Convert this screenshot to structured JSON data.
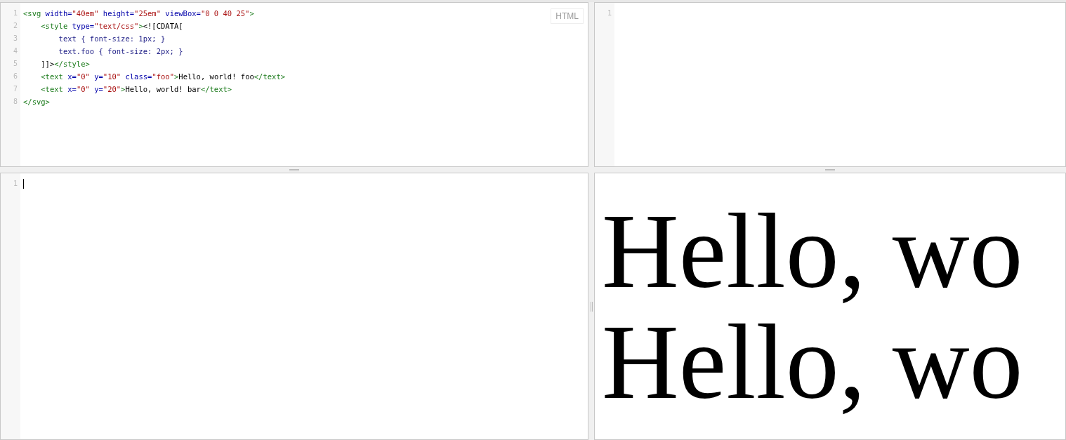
{
  "html_editor": {
    "label": "HTML",
    "lines": [
      {
        "number": "1",
        "tokens": [
          {
            "kind": "tag",
            "text": "<svg "
          },
          {
            "kind": "attr",
            "text": "width="
          },
          {
            "kind": "string",
            "text": "\"40em\""
          },
          {
            "kind": "attr",
            "text": " height="
          },
          {
            "kind": "string",
            "text": "\"25em\""
          },
          {
            "kind": "attr",
            "text": " viewBox="
          },
          {
            "kind": "string",
            "text": "\"0 0 40 25\""
          },
          {
            "kind": "tag",
            "text": ">"
          }
        ]
      },
      {
        "number": "2",
        "tokens": [
          {
            "kind": "tag",
            "text": "    <style "
          },
          {
            "kind": "attr",
            "text": "type="
          },
          {
            "kind": "string",
            "text": "\"text/css\""
          },
          {
            "kind": "tag",
            "text": ">"
          },
          {
            "kind": "text",
            "text": "<![CDATA["
          }
        ]
      },
      {
        "number": "3",
        "tokens": [
          {
            "kind": "css",
            "text": "        text { font-size: 1px; }"
          }
        ]
      },
      {
        "number": "4",
        "tokens": [
          {
            "kind": "css",
            "text": "        text.foo { font-size: 2px; }"
          }
        ]
      },
      {
        "number": "5",
        "tokens": [
          {
            "kind": "text",
            "text": "    ]]>"
          },
          {
            "kind": "tag",
            "text": "</style>"
          }
        ]
      },
      {
        "number": "6",
        "tokens": [
          {
            "kind": "tag",
            "text": "    <text "
          },
          {
            "kind": "attr",
            "text": "x="
          },
          {
            "kind": "string",
            "text": "\"0\""
          },
          {
            "kind": "attr",
            "text": " y="
          },
          {
            "kind": "string",
            "text": "\"10\""
          },
          {
            "kind": "attr",
            "text": " class="
          },
          {
            "kind": "string",
            "text": "\"foo\""
          },
          {
            "kind": "tag",
            "text": ">"
          },
          {
            "kind": "text",
            "text": "Hello, world! foo"
          },
          {
            "kind": "tag",
            "text": "</text>"
          }
        ]
      },
      {
        "number": "7",
        "tokens": [
          {
            "kind": "tag",
            "text": "    <text "
          },
          {
            "kind": "attr",
            "text": "x="
          },
          {
            "kind": "string",
            "text": "\"0\""
          },
          {
            "kind": "attr",
            "text": " y="
          },
          {
            "kind": "string",
            "text": "\"20\""
          },
          {
            "kind": "tag",
            "text": ">"
          },
          {
            "kind": "text",
            "text": "Hello, world! bar"
          },
          {
            "kind": "tag",
            "text": "</text>"
          }
        ]
      },
      {
        "number": "8",
        "tokens": [
          {
            "kind": "tag",
            "text": "</svg>"
          }
        ]
      }
    ]
  },
  "css_editor": {
    "line_numbers": [
      "1"
    ]
  },
  "js_editor": {
    "line_numbers": [
      "1"
    ],
    "focused": true
  },
  "result": {
    "lines": [
      {
        "text": "Hello, wo",
        "kind": "large"
      },
      {
        "text": "Hello, wo",
        "kind": "large"
      }
    ]
  }
}
